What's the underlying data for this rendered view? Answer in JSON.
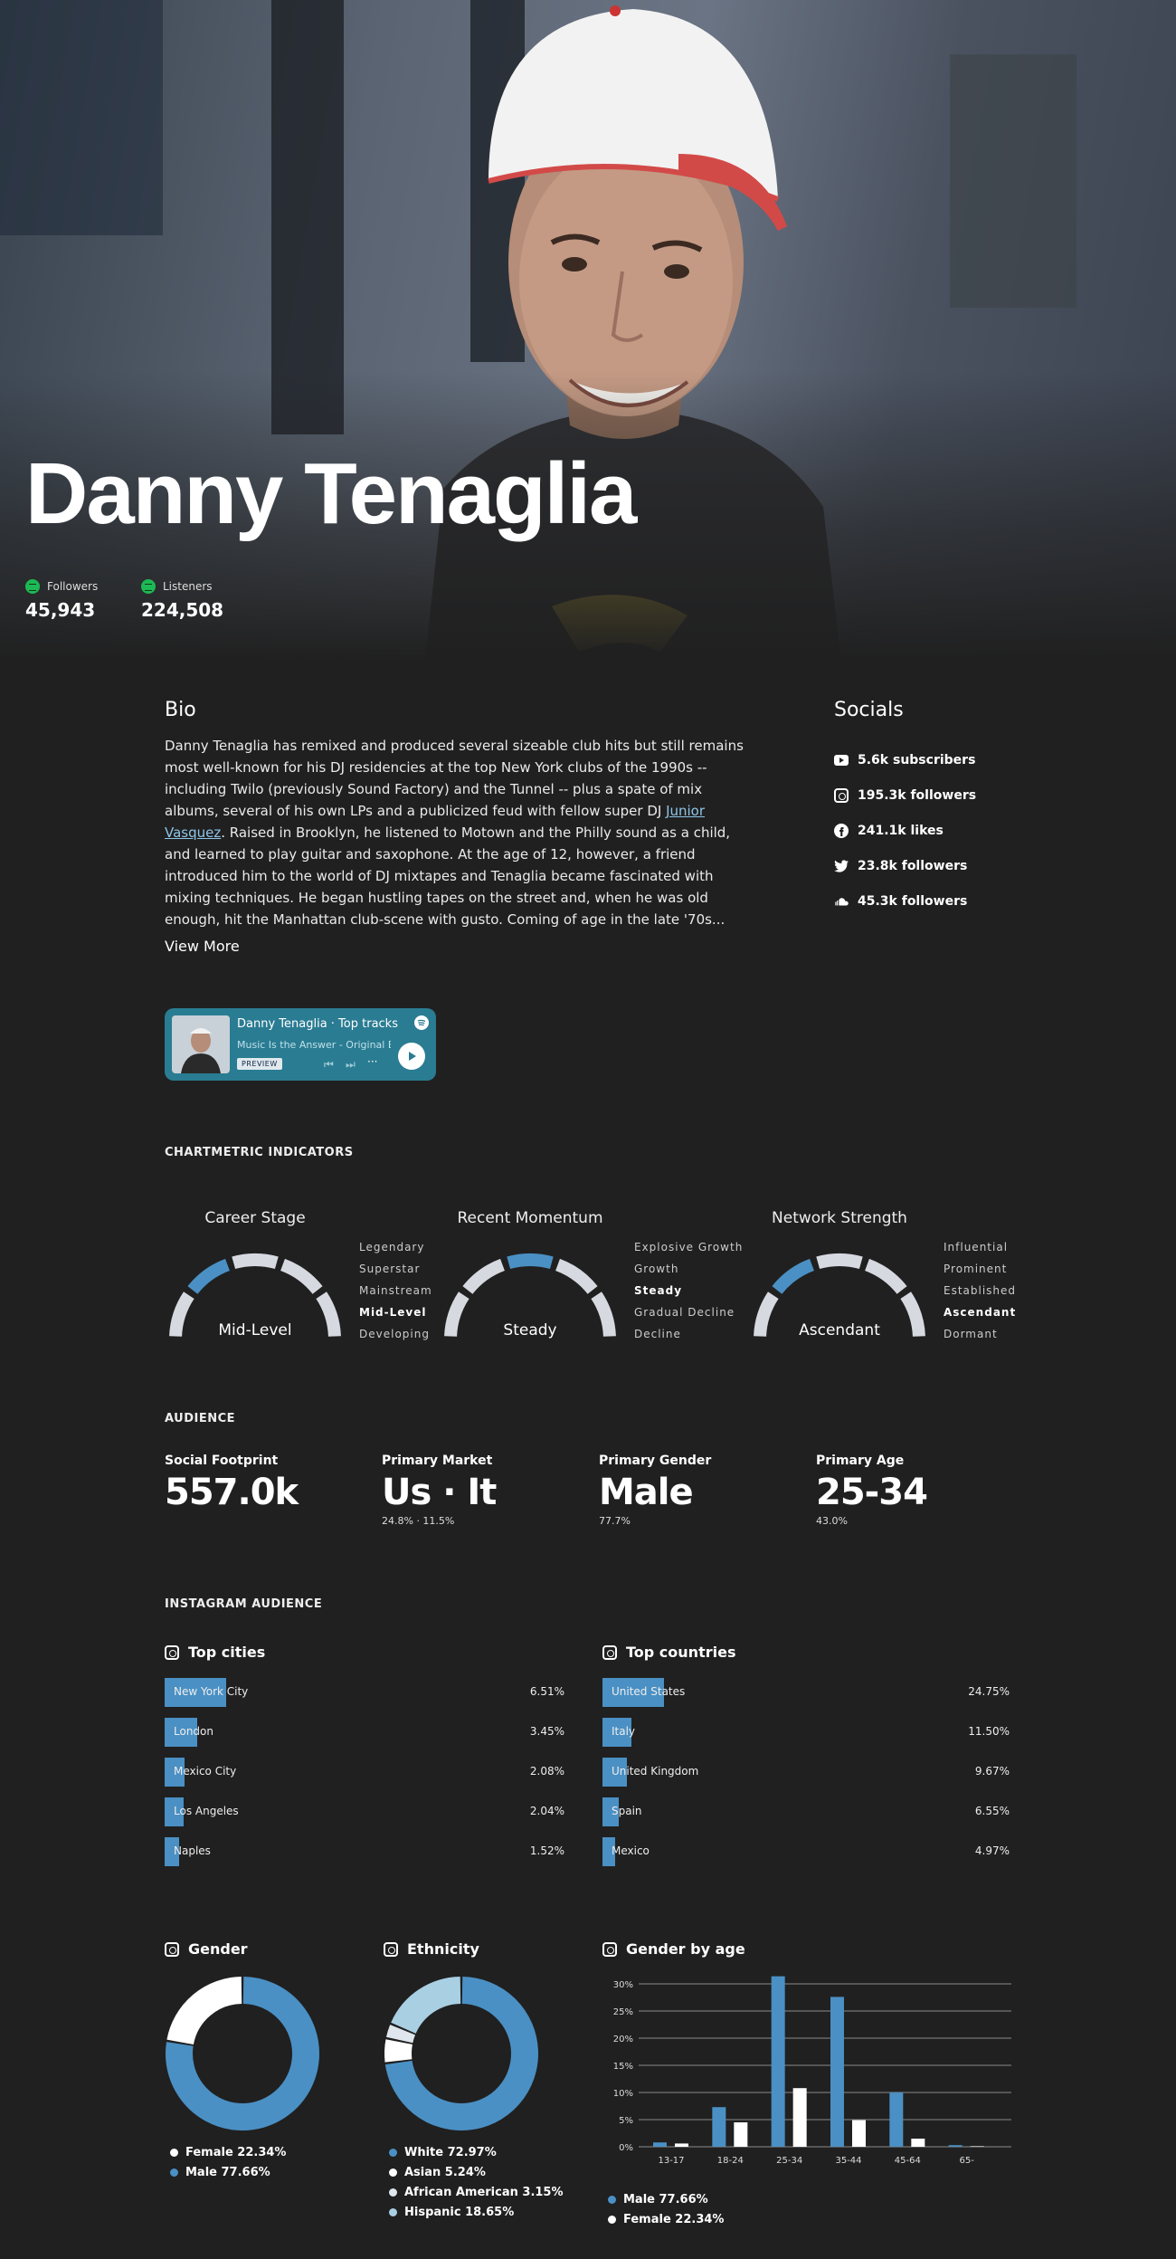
{
  "artist": {
    "name": "Danny Tenaglia",
    "followers_label": "Followers",
    "followers_value": "45,943",
    "listeners_label": "Listeners",
    "listeners_value": "224,508"
  },
  "bio": {
    "heading": "Bio",
    "text_before_link": "Danny Tenaglia has remixed and produced several sizeable club hits but still remains most well-known for his DJ residencies at the top New York clubs of the 1990s -- including Twilo (previously Sound Factory) and the Tunnel -- plus a spate of mix albums, several of his own LPs and a publicized feud with fellow super DJ ",
    "link_text": "Junior Vasquez",
    "text_after_link": ". Raised in Brooklyn, he listened to Motown and the Philly sound as a child, and learned to play guitar and saxophone. At the age of 12, however, a friend introduced him to the world of DJ mixtapes and Tenaglia became fascinated with mixing techniques. He began hustling tapes on the street and, when he was old enough, hit the Manhattan club-scene with gusto. Coming of age in the late '70s...",
    "view_more": "View More"
  },
  "socials": {
    "heading": "Socials",
    "items": [
      {
        "icon": "youtube-icon",
        "text": "5.6k subscribers"
      },
      {
        "icon": "instagram-icon",
        "text": "195.3k followers"
      },
      {
        "icon": "facebook-icon",
        "text": "241.1k likes"
      },
      {
        "icon": "twitter-icon",
        "text": "23.8k followers"
      },
      {
        "icon": "soundcloud-icon",
        "text": "45.3k followers"
      }
    ]
  },
  "embed": {
    "title": "Danny Tenaglia · Top tracks",
    "subtitle": "Music Is the Answer - Original Exte",
    "preview": "PREVIEW",
    "bg_color": "#2a7c92"
  },
  "indicators": {
    "heading": "CHARTMETRIC INDICATORS",
    "gauges": [
      {
        "title": "Career Stage",
        "value": "Mid-Level",
        "levels": [
          "Legendary",
          "Superstar",
          "Mainstream",
          "Mid-Level",
          "Developing"
        ],
        "active_index": 3
      },
      {
        "title": "Recent Momentum",
        "value": "Steady",
        "levels": [
          "Explosive Growth",
          "Growth",
          "Steady",
          "Gradual Decline",
          "Decline"
        ],
        "active_index": 2
      },
      {
        "title": "Network Strength",
        "value": "Ascendant",
        "levels": [
          "Influential",
          "Prominent",
          "Established",
          "Ascendant",
          "Dormant"
        ],
        "active_index": 3
      }
    ]
  },
  "audience": {
    "heading": "AUDIENCE",
    "stats": [
      {
        "label": "Social Footprint",
        "value": "557.0k",
        "sub": ""
      },
      {
        "label": "Primary Market",
        "value": "Us · It",
        "sub": "24.8% · 11.5%"
      },
      {
        "label": "Primary Gender",
        "value": "Male",
        "sub": "77.7%"
      },
      {
        "label": "Primary Age",
        "value": "25-34",
        "sub": "43.0%"
      }
    ]
  },
  "instagram": {
    "heading": "INSTAGRAM AUDIENCE",
    "cities_heading": "Top cities",
    "countries_heading": "Top countries",
    "cities": [
      {
        "name": "New York City",
        "pct": "6.51%",
        "value": 6.51
      },
      {
        "name": "London",
        "pct": "3.45%",
        "value": 3.45
      },
      {
        "name": "Mexico City",
        "pct": "2.08%",
        "value": 2.08
      },
      {
        "name": "Los Angeles",
        "pct": "2.04%",
        "value": 2.04
      },
      {
        "name": "Naples",
        "pct": "1.52%",
        "value": 1.52
      }
    ],
    "countries": [
      {
        "name": "United States",
        "pct": "24.75%",
        "value": 24.75
      },
      {
        "name": "Italy",
        "pct": "11.50%",
        "value": 11.5
      },
      {
        "name": "United Kingdom",
        "pct": "9.67%",
        "value": 9.67
      },
      {
        "name": "Spain",
        "pct": "6.55%",
        "value": 6.55
      },
      {
        "name": "Mexico",
        "pct": "4.97%",
        "value": 4.97
      }
    ],
    "gender_heading": "Gender",
    "ethnicity_heading": "Ethnicity",
    "gender_by_age_heading": "Gender by age"
  },
  "colors": {
    "accent": "#4a90c4",
    "background": "#202020",
    "light_blue": "#a9cfe3",
    "white": "#ffffff"
  },
  "chart_data": [
    {
      "type": "pie",
      "title": "Gender",
      "labels": [
        "Female 22.34%",
        "Male 77.66%"
      ],
      "values": [
        22.34,
        77.66
      ],
      "colors": [
        "#ffffff",
        "#4a90c4"
      ]
    },
    {
      "type": "pie",
      "title": "Ethnicity",
      "labels": [
        "White 72.97%",
        "Asian 5.24%",
        "African American 3.15%",
        "Hispanic 18.65%"
      ],
      "values": [
        72.97,
        5.24,
        3.15,
        18.65
      ],
      "colors": [
        "#4a90c4",
        "#ffffff",
        "#dfe6ee",
        "#a9cfe3"
      ]
    },
    {
      "type": "bar",
      "title": "Gender by age",
      "categories": [
        "13-17",
        "18-24",
        "25-34",
        "35-44",
        "45-64",
        "65-"
      ],
      "series": [
        {
          "name": "Male 77.66%",
          "values": [
            0.8,
            7.3,
            31.4,
            27.6,
            10.0,
            0.3
          ],
          "color": "#4a90c4"
        },
        {
          "name": "Female 22.34%",
          "values": [
            0.6,
            4.5,
            10.8,
            4.9,
            1.5,
            0.1
          ],
          "color": "#ffffff"
        }
      ],
      "ylim": [
        0,
        30
      ],
      "yticks": [
        "0%",
        "5%",
        "10%",
        "15%",
        "20%",
        "25%",
        "30%"
      ],
      "grid": true,
      "legend": "bottom-left"
    }
  ]
}
